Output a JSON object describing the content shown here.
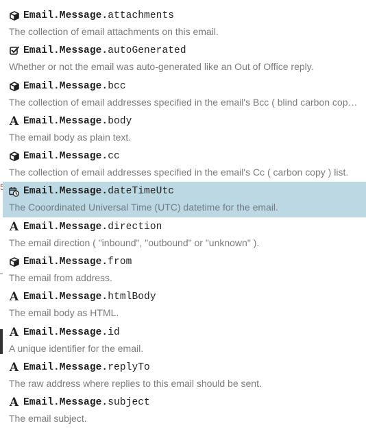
{
  "edge": {
    "glyph": "5"
  },
  "items": [
    {
      "icon": "cube-icon",
      "namespace": "Email.Message.",
      "member": "attachments",
      "description": "The collection of email attachments on this email."
    },
    {
      "icon": "checkbox-icon",
      "namespace": "Email.Message.",
      "member": "autoGenerated",
      "description": "Whether or not the email was auto-generated like an Out of Office reply."
    },
    {
      "icon": "cube-icon",
      "namespace": "Email.Message.",
      "member": "bcc",
      "description": "The collection of email addresses specified in the email's Bcc ( blind carbon copy ) list."
    },
    {
      "icon": "text-type-icon",
      "icon_glyph": "A",
      "namespace": "Email.Message.",
      "member": "body",
      "description": "The email body as plain text."
    },
    {
      "icon": "cube-icon",
      "namespace": "Email.Message.",
      "member": "cc",
      "description": "The collection of email addresses specified in the email's Cc ( carbon copy ) list."
    },
    {
      "icon": "calendar-clock-icon",
      "namespace": "Email.Message.",
      "member": "dateTimeUtc",
      "description": "The Cooordinated Universal Time (UTC) datetime for the email.",
      "selected": true
    },
    {
      "icon": "text-type-icon",
      "icon_glyph": "A",
      "namespace": "Email.Message.",
      "member": "direction",
      "description": "The email direction ( \"inbound\", \"outbound\" or \"unknown\" )."
    },
    {
      "icon": "cube-icon",
      "namespace": "Email.Message.",
      "member": "from",
      "description": "The email from address."
    },
    {
      "icon": "text-type-icon",
      "icon_glyph": "A",
      "namespace": "Email.Message.",
      "member": "htmlBody",
      "description": "The email body as HTML."
    },
    {
      "icon": "text-type-icon",
      "icon_glyph": "A",
      "namespace": "Email.Message.",
      "member": "id",
      "description": "A unique identifier for the email."
    },
    {
      "icon": "text-type-icon",
      "icon_glyph": "A",
      "namespace": "Email.Message.",
      "member": "replyTo",
      "description": "The raw address where replies to this email should be sent."
    },
    {
      "icon": "text-type-icon",
      "icon_glyph": "A",
      "namespace": "Email.Message.",
      "member": "subject",
      "description": "The email subject."
    }
  ],
  "colors": {
    "selected_background": "#bcd8e2",
    "description_text": "#7a7a7a",
    "name_text": "#1f1f1f"
  }
}
